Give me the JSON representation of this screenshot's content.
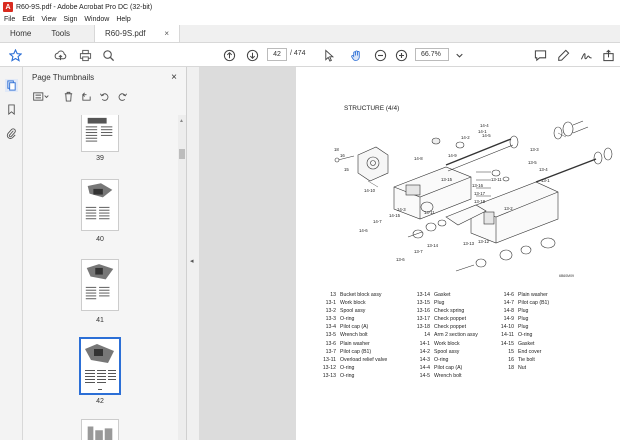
{
  "window": {
    "title": "R60-9S.pdf - Adobe Acrobat Pro DC (32-bit)"
  },
  "menu": [
    "File",
    "Edit",
    "View",
    "Sign",
    "Window",
    "Help"
  ],
  "tabs": {
    "home": "Home",
    "tools": "Tools",
    "document": "R60-9S.pdf",
    "close": "×"
  },
  "toolbar": {
    "page_current": "42",
    "page_total": "474",
    "zoom": "66.7%"
  },
  "panel": {
    "title": "Page Thumbnails",
    "close": "×"
  },
  "thumbnails": [
    {
      "label": "39",
      "selected": false
    },
    {
      "label": "40",
      "selected": false
    },
    {
      "label": "41",
      "selected": false
    },
    {
      "label": "42",
      "selected": true
    }
  ],
  "document": {
    "heading": "STRUCTURE (4/4)",
    "figure_code": "6B60M09",
    "callouts": [
      "18",
      "16",
      "15",
      "14-8",
      "14-9",
      "14-3",
      "14-2",
      "14-10",
      "14-7",
      "14-6",
      "14-15",
      "14-1",
      "14-11",
      "13-15",
      "13-16",
      "13-17",
      "13-18",
      "13-2",
      "13-11",
      "13-13",
      "13-12",
      "13-14",
      "13-7",
      "13-6",
      "13-5",
      "13-4",
      "13-1",
      "13-3",
      "14-4",
      "14-5"
    ],
    "parts_col1": [
      {
        "no": "13",
        "name": "Bucket block assy"
      },
      {
        "no": "13-1",
        "name": "Work block"
      },
      {
        "no": "13-2",
        "name": "Spool assy"
      },
      {
        "no": "13-3",
        "name": "O-ring"
      },
      {
        "no": "13-4",
        "name": "Pilot cap (A)"
      },
      {
        "no": "13-5",
        "name": "Wrench bolt"
      },
      {
        "no": "13-6",
        "name": "Plain washer"
      },
      {
        "no": "13-7",
        "name": "Pilot cap (B1)"
      },
      {
        "no": "13-11",
        "name": "Overload relief valve"
      },
      {
        "no": "13-12",
        "name": "O-ring"
      },
      {
        "no": "13-13",
        "name": "O-ring"
      }
    ],
    "parts_col2": [
      {
        "no": "13-14",
        "name": "Gasket"
      },
      {
        "no": "13-15",
        "name": "Plug"
      },
      {
        "no": "13-16",
        "name": "Check spring"
      },
      {
        "no": "13-17",
        "name": "Check poppet"
      },
      {
        "no": "13-18",
        "name": "Check poppet"
      },
      {
        "no": "14",
        "name": "Arm 2 section assy"
      },
      {
        "no": "14-1",
        "name": "Work block"
      },
      {
        "no": "14-2",
        "name": "Spool assy"
      },
      {
        "no": "14-3",
        "name": "O-ring"
      },
      {
        "no": "14-4",
        "name": "Pilot cap (A)"
      },
      {
        "no": "14-5",
        "name": "Wrench bolt"
      }
    ],
    "parts_col3": [
      {
        "no": "14-6",
        "name": "Plain washer"
      },
      {
        "no": "14-7",
        "name": "Pilot cap (B1)"
      },
      {
        "no": "14-8",
        "name": "Plug"
      },
      {
        "no": "14-9",
        "name": "Plug"
      },
      {
        "no": "14-10",
        "name": "Plug"
      },
      {
        "no": "14-11",
        "name": "O-ring"
      },
      {
        "no": "14-15",
        "name": "Gasket"
      },
      {
        "no": "15",
        "name": "End cover"
      },
      {
        "no": "16",
        "name": "Tie bolt"
      },
      {
        "no": "18",
        "name": "Nut"
      }
    ]
  }
}
